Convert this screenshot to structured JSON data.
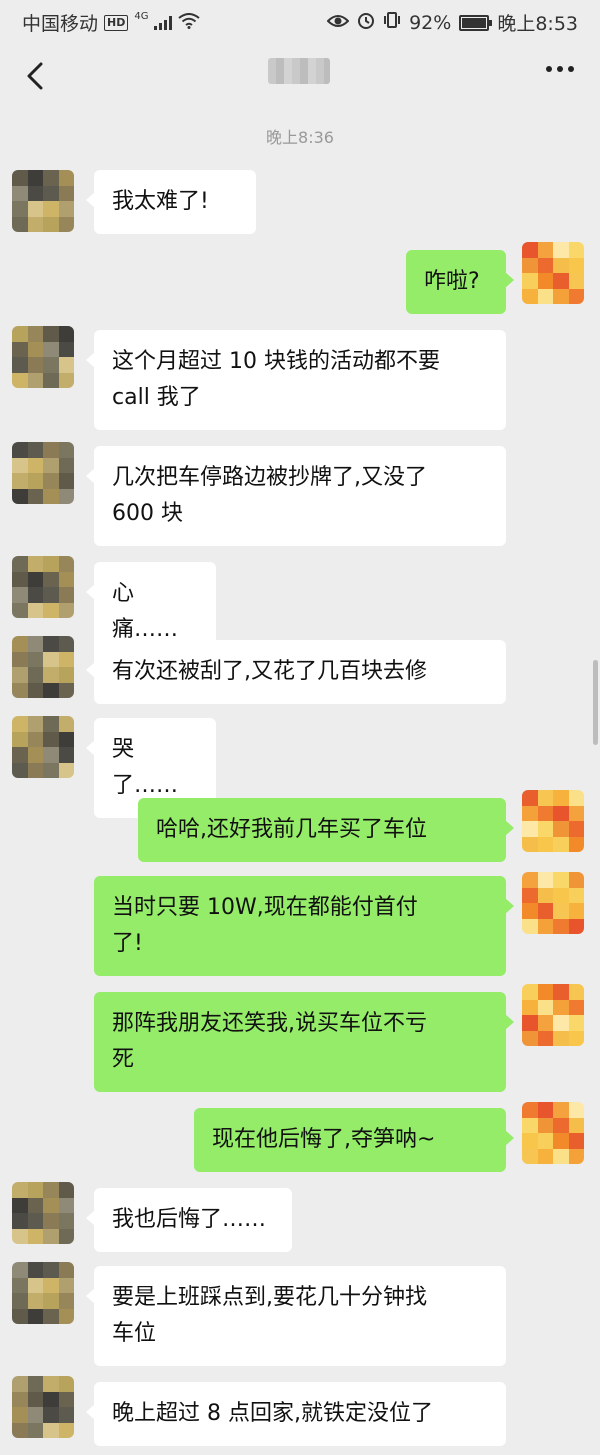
{
  "status_bar": {
    "carrier": "中国移动",
    "hd": "HD",
    "network": "4G",
    "battery": "92%",
    "time": "晚上8:53"
  },
  "header": {
    "back_icon": "chevron-left-icon",
    "more_icon": "more-horizontal-icon"
  },
  "chat": {
    "timestamp": "晚上8:36",
    "messages": [
      {
        "side": "left",
        "text": "我太难了!"
      },
      {
        "side": "right",
        "text": "咋啦?"
      },
      {
        "side": "left",
        "text": "这个月超过 10 块钱的活动都不要\ncall 我了"
      },
      {
        "side": "left",
        "text": "几次把车停路边被抄牌了,又没了\n600 块"
      },
      {
        "side": "left",
        "text": "心痛……"
      },
      {
        "side": "left",
        "text": "有次还被刮了,又花了几百块去修"
      },
      {
        "side": "left",
        "text": "哭了……"
      },
      {
        "side": "right",
        "text": "哈哈,还好我前几年买了车位"
      },
      {
        "side": "right",
        "text": "当时只要 10W,现在都能付首付\n了!"
      },
      {
        "side": "right",
        "text": "那阵我朋友还笑我,说买车位不亏\n死"
      },
      {
        "side": "right",
        "text": "现在他后悔了,夺笋呐~"
      },
      {
        "side": "left",
        "text": "我也后悔了……"
      },
      {
        "side": "left",
        "text": "要是上班踩点到,要花几十分钟找\n车位"
      },
      {
        "side": "left",
        "text": "晚上超过 8 点回家,就铁定没位了"
      }
    ]
  },
  "colors": {
    "background": "#ededed",
    "bubble_self": "#95ec69",
    "bubble_other": "#ffffff"
  }
}
